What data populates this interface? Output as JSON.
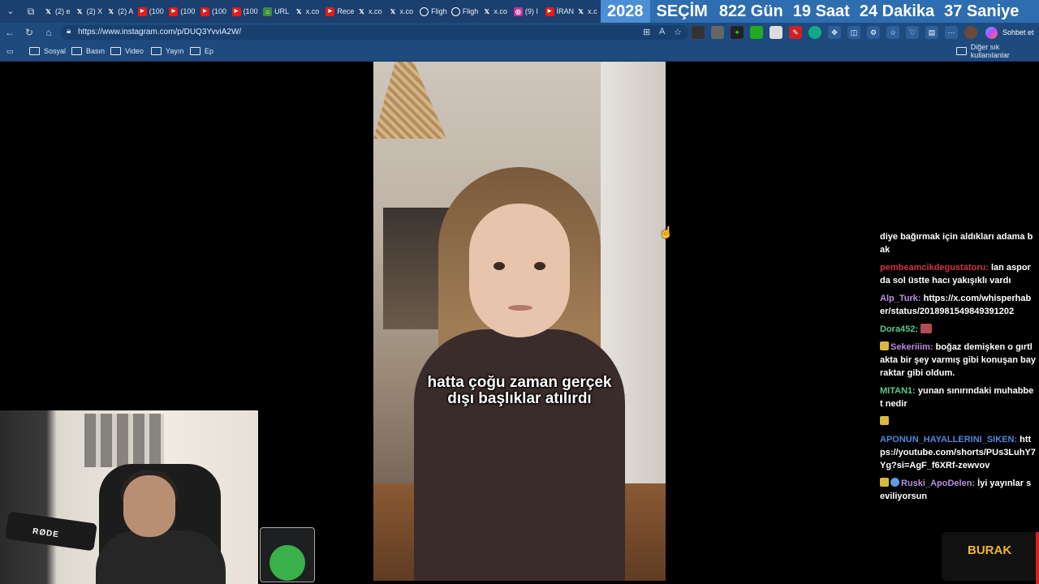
{
  "tabs": [
    {
      "icon": "x",
      "label": "(2) e"
    },
    {
      "icon": "x",
      "label": "(2) X"
    },
    {
      "icon": "x",
      "label": "(2) A"
    },
    {
      "icon": "yt",
      "label": "(100"
    },
    {
      "icon": "yt",
      "label": "(100"
    },
    {
      "icon": "yt",
      "label": "(100"
    },
    {
      "icon": "yt",
      "label": "(100"
    },
    {
      "icon": "url",
      "label": "URL"
    },
    {
      "icon": "x",
      "label": "x.co"
    },
    {
      "icon": "yt",
      "label": "Rece"
    },
    {
      "icon": "x",
      "label": "x.co"
    },
    {
      "icon": "x",
      "label": "x.co"
    },
    {
      "icon": "fl",
      "label": "Fligh"
    },
    {
      "icon": "fl",
      "label": "Fligh"
    },
    {
      "icon": "x",
      "label": "x.co"
    },
    {
      "icon": "ig",
      "label": "(9) I"
    },
    {
      "icon": "yt",
      "label": "İRAN"
    },
    {
      "icon": "x",
      "label": "x.c"
    }
  ],
  "countdown": {
    "year": "2028",
    "label": "SEÇİM",
    "days": "822 Gün",
    "hours": "19 Saat",
    "minutes": "24 Dakika",
    "seconds": "37 Saniye"
  },
  "address": {
    "url": "https://www.instagram.com/p/DUQ3YvviA2W/"
  },
  "copilot": {
    "label": "Sohbet et"
  },
  "bookmarks": [
    "Sosyal",
    "Basın",
    "Video",
    "Yayın",
    "Ep"
  ],
  "bookmarks_other": "Diğer sık kullanılanlar",
  "video": {
    "subtitle_line1": "hatta çoğu zaman gerçek",
    "subtitle_line2": "dışı başlıklar atılırdı"
  },
  "webcam": {
    "mic_brand": "RØDE"
  },
  "chat": [
    {
      "user": "",
      "color": "#ffffff",
      "text": "diye bağırmak için aldıkları adama bak"
    },
    {
      "user": "pembeamcikdegustatoru:",
      "color": "#d6334a",
      "text": "lan asporda sol üstte hacı yakışıklı vardı"
    },
    {
      "user": "Alp_Turk:",
      "color": "#b98de0",
      "text": "https://x.com/whisperhaber/status/2018981549849391202"
    },
    {
      "user": "Dora452:",
      "color": "#58c98d",
      "text": ""
    },
    {
      "user": "Sekeriiim:",
      "color": "#b98de0",
      "text": "boğaz demişken o gırtlakta bir şey varmış gibi konuşan bayraktar gibi oldum."
    },
    {
      "user": "MITAN1:",
      "color": "#58c98d",
      "text": "yunan sınırındaki muhabbet nedir"
    },
    {
      "user": "",
      "color": "#ffffff",
      "text": ""
    },
    {
      "user": "APONUN_HAYALLERINI_SIKEN:",
      "color": "#4f86e0",
      "text": "https://youtube.com/shorts/PUs3LuhY7Yg?si=AgF_f6XRf-zewvov"
    },
    {
      "user": "Ruski_ApoDelen:",
      "color": "#b98de0",
      "text": "İyi yayınlar seviliyorsun"
    }
  ],
  "overlay": {
    "name": "BURAK"
  },
  "colors": {
    "tabbar": "#1b3f6e",
    "countdown": "#2e6db0",
    "addressbar": "#1e4a7e",
    "overlay_text": "#f0b52c"
  }
}
